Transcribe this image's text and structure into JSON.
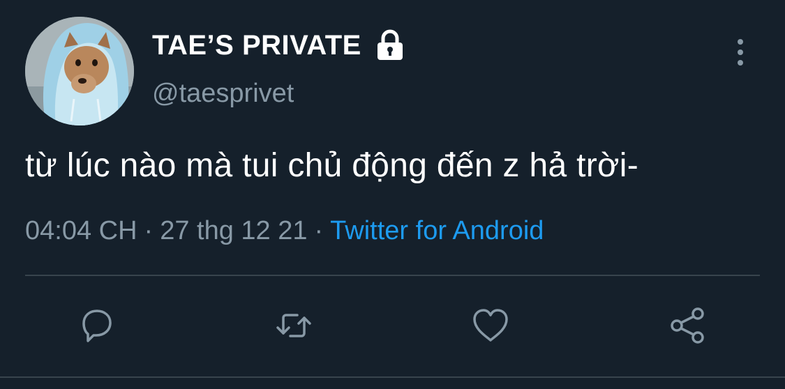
{
  "user": {
    "display_name": "TAE’S PRIVATE",
    "handle": "@taesprivet",
    "protected_icon": "lock-icon",
    "avatar": "dog-in-blue-hoodie"
  },
  "tweet": {
    "text": "từ lúc nào mà tui chủ động đến z hả trời-",
    "time": "04:04 CH",
    "separator": "·",
    "date": "27 thg 12 21",
    "source": "Twitter for Android"
  },
  "actions": [
    {
      "name": "reply",
      "icon": "reply-icon"
    },
    {
      "name": "retweet",
      "icon": "retweet-icon"
    },
    {
      "name": "like",
      "icon": "heart-icon"
    },
    {
      "name": "share",
      "icon": "share-icon"
    }
  ],
  "colors": {
    "background": "#15202b",
    "text_primary": "#ffffff",
    "text_secondary": "#8899a6",
    "link": "#1d9bf0",
    "divider": "#38444d"
  }
}
